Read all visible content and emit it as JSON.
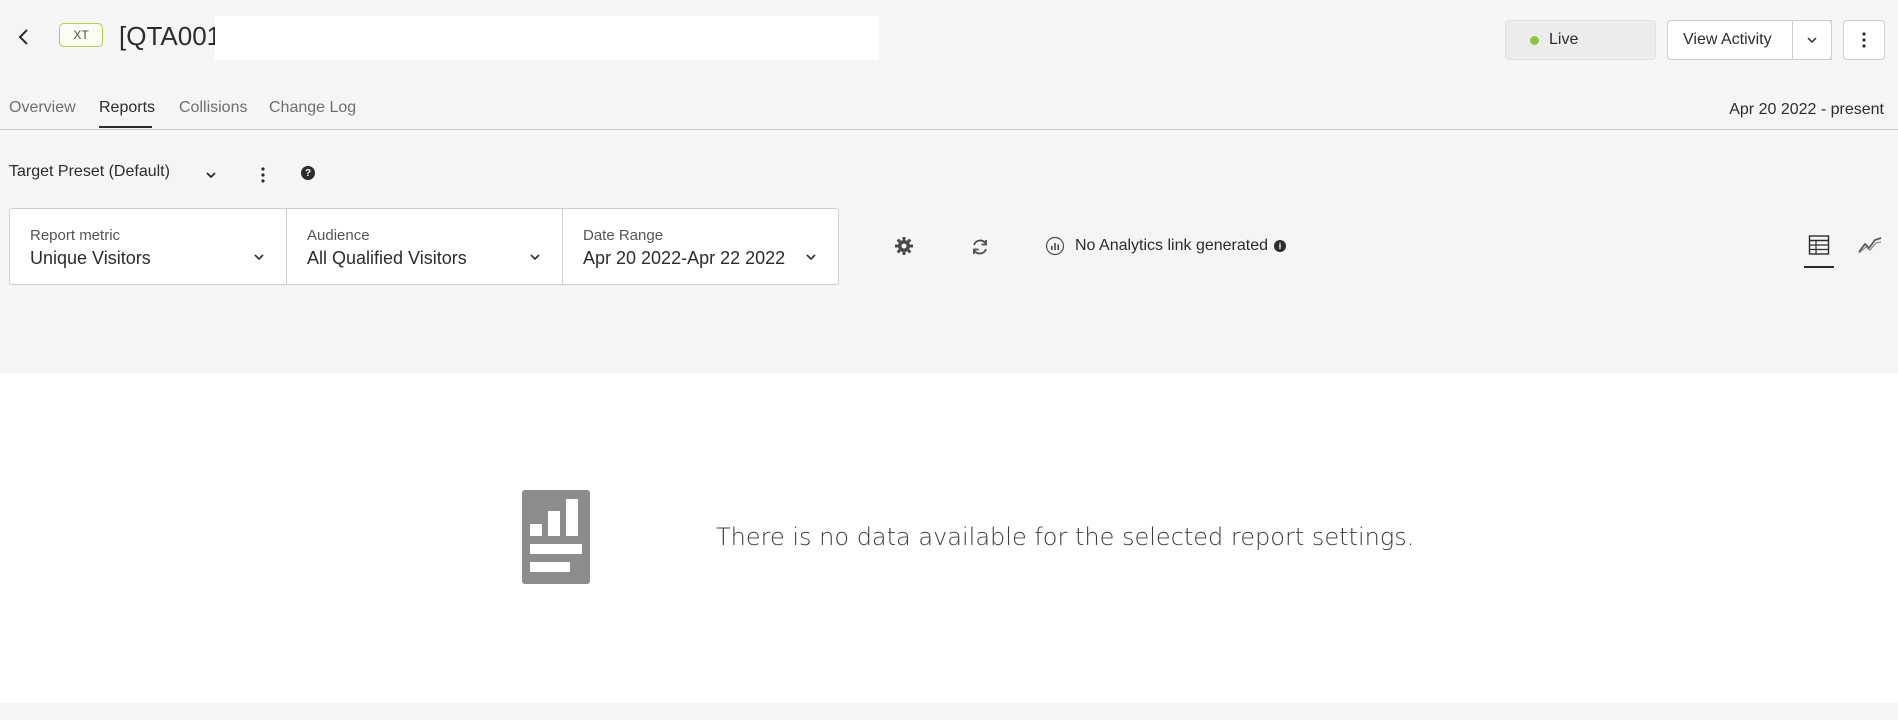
{
  "header": {
    "type_badge": "XT",
    "title": "[QTA001]",
    "title_field_value": "",
    "status_label": "Live",
    "status_color": "#8dc63f",
    "view_activity_label": "View Activity"
  },
  "tabs": {
    "items": [
      {
        "label": "Overview"
      },
      {
        "label": "Reports"
      },
      {
        "label": "Collisions"
      },
      {
        "label": "Change Log"
      }
    ],
    "active": "Reports",
    "date_meta": "Apr 20 2022 - present"
  },
  "toolbar": {
    "preset_label": "Target Preset (Default)",
    "selectors": [
      {
        "label": "Report metric",
        "value": "Unique Visitors"
      },
      {
        "label": "Audience",
        "value": "All Qualified Visitors"
      },
      {
        "label": "Date Range",
        "value": "Apr 20 2022-Apr 22 2022"
      }
    ],
    "analytics_note": "No Analytics link generated"
  },
  "content": {
    "empty_message": "There is no data available for the selected report settings."
  },
  "colors": {
    "badge_border": "#b4cd4f",
    "background": "#f5f5f5",
    "panel": "#ffffff"
  }
}
